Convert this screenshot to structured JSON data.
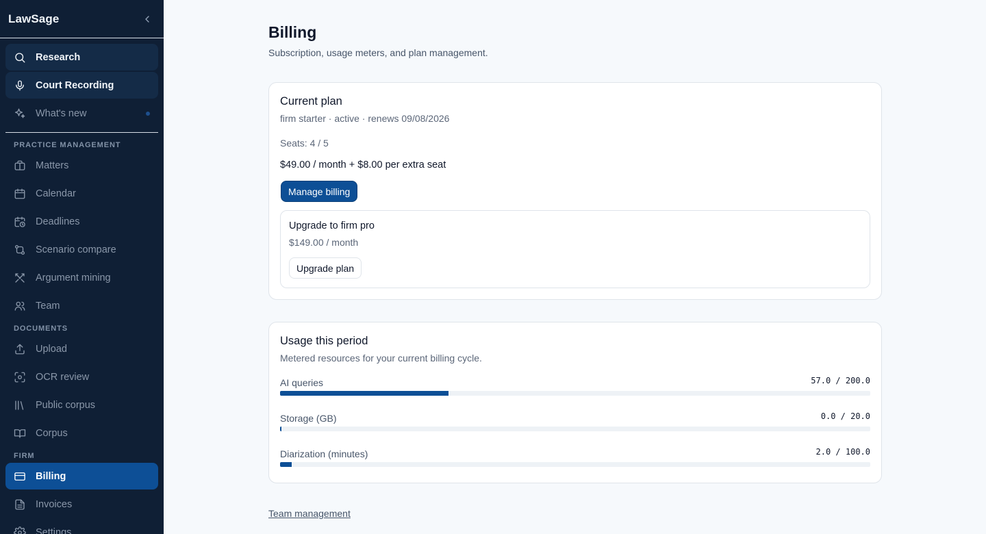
{
  "app": {
    "name": "LawSage"
  },
  "sidebar": {
    "top_items": [
      {
        "label": "Research",
        "icon": "search-icon"
      },
      {
        "label": "Court Recording",
        "icon": "microphone-icon"
      },
      {
        "label": "What's new",
        "icon": "sparkles-icon"
      }
    ],
    "sections": [
      {
        "label": "PRACTICE MANAGEMENT",
        "items": [
          {
            "label": "Matters",
            "icon": "briefcase-icon"
          },
          {
            "label": "Calendar",
            "icon": "calendar-icon"
          },
          {
            "label": "Deadlines",
            "icon": "calendar-clock-icon"
          },
          {
            "label": "Scenario compare",
            "icon": "git-compare-icon"
          },
          {
            "label": "Argument mining",
            "icon": "swords-icon"
          },
          {
            "label": "Team",
            "icon": "users-icon"
          }
        ]
      },
      {
        "label": "DOCUMENTS",
        "items": [
          {
            "label": "Upload",
            "icon": "upload-icon"
          },
          {
            "label": "OCR review",
            "icon": "scan-icon"
          },
          {
            "label": "Public corpus",
            "icon": "library-icon"
          },
          {
            "label": "Corpus",
            "icon": "book-open-icon"
          }
        ]
      },
      {
        "label": "FIRM",
        "items": [
          {
            "label": "Billing",
            "icon": "credit-card-icon"
          },
          {
            "label": "Invoices",
            "icon": "file-text-icon"
          },
          {
            "label": "Settings",
            "icon": "gear-icon"
          }
        ]
      }
    ]
  },
  "page": {
    "title": "Billing",
    "subtitle": "Subscription, usage meters, and plan management."
  },
  "plan": {
    "title": "Current plan",
    "status": "firm starter · active · renews 09/08/2026",
    "seats": "Seats: 4 / 5",
    "price": "$49.00 / month + $8.00 per extra seat",
    "manage_label": "Manage billing",
    "upgrade": {
      "title": "Upgrade to firm pro",
      "price": "$149.00 / month",
      "button_label": "Upgrade plan"
    }
  },
  "usage": {
    "title": "Usage this period",
    "subtitle": "Metered resources for your current billing cycle.",
    "meters": [
      {
        "label": "AI queries",
        "value_text": "57.0 / 200.0",
        "used": 57.0,
        "limit": 200.0
      },
      {
        "label": "Storage (GB)",
        "value_text": "0.0 / 20.0",
        "used": 0.0,
        "limit": 20.0
      },
      {
        "label": "Diarization (minutes)",
        "value_text": "2.0 / 100.0",
        "used": 2.0,
        "limit": 100.0
      }
    ]
  },
  "footer": {
    "team_link": "Team management"
  },
  "colors": {
    "sidebar_bg": "#0f1f35",
    "accent": "#0d4f96",
    "page_bg": "#f6f9fc"
  }
}
